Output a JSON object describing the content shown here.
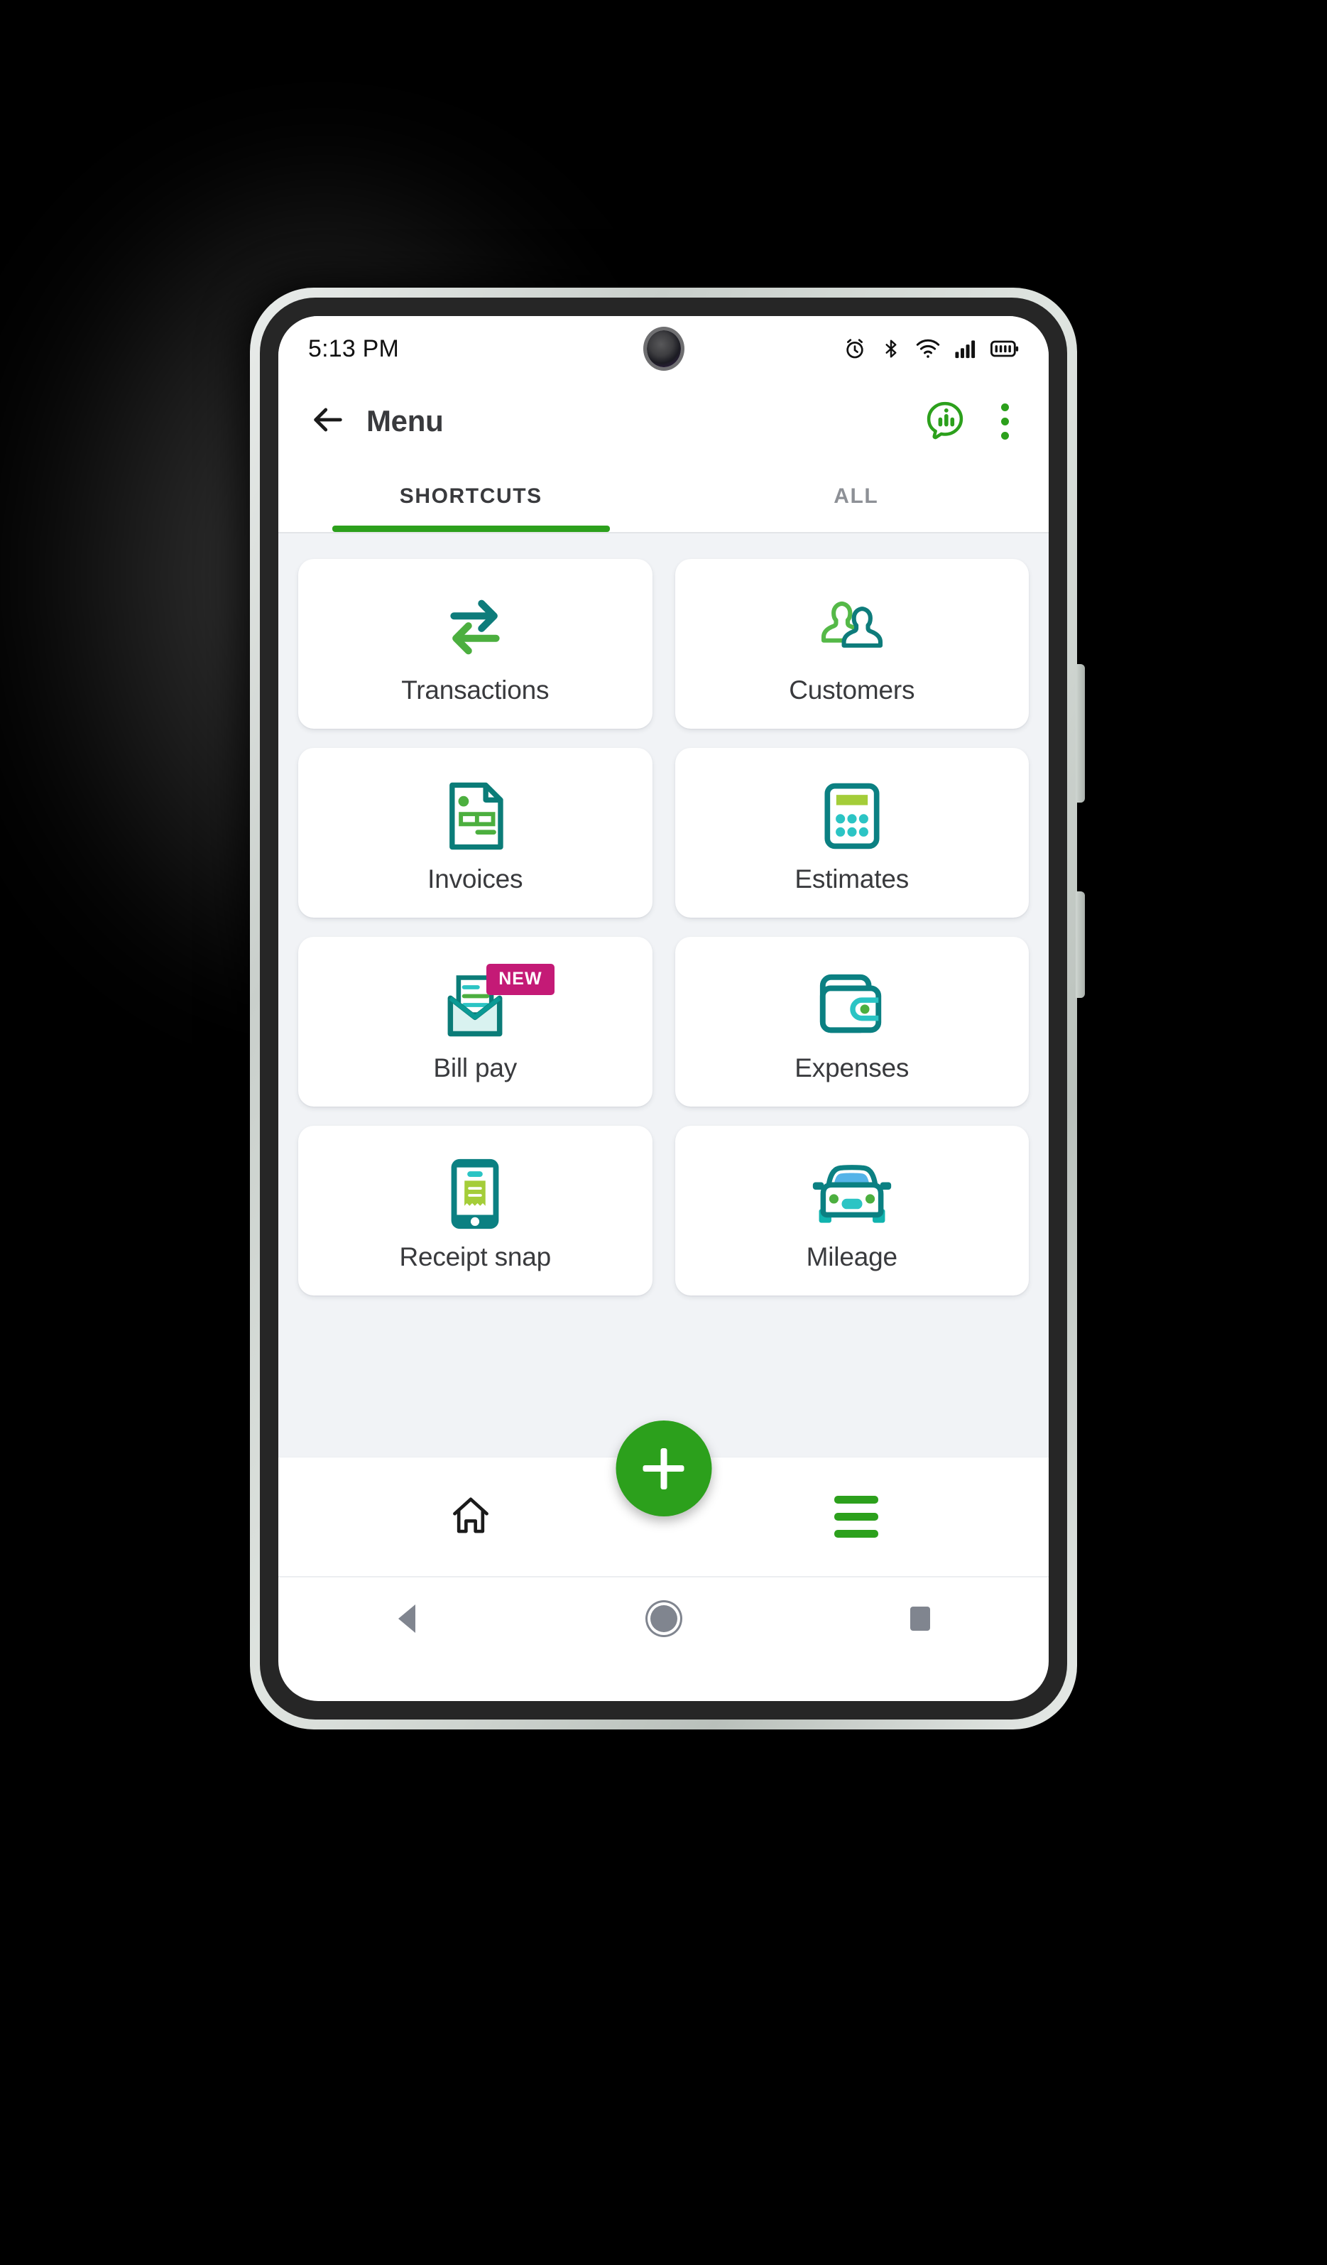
{
  "status_bar": {
    "time": "5:13 PM",
    "icons": [
      "alarm-icon",
      "bluetooth-icon",
      "wifi-icon",
      "cellular-signal-icon",
      "battery-icon"
    ]
  },
  "app_bar": {
    "back_icon": "arrow-left-icon",
    "title": "Menu",
    "assistant_icon": "assistant-chat-bars-icon",
    "overflow_icon": "overflow-menu-icon"
  },
  "tabs": {
    "items": [
      {
        "label": "SHORTCUTS",
        "active": true
      },
      {
        "label": "ALL",
        "active": false
      }
    ],
    "indicator_color": "#2ca01c"
  },
  "shortcuts": [
    {
      "label": "Transactions",
      "icon": "transfer-arrows-icon",
      "badge": null
    },
    {
      "label": "Customers",
      "icon": "people-icon",
      "badge": null
    },
    {
      "label": "Invoices",
      "icon": "invoice-document-icon",
      "badge": null
    },
    {
      "label": "Estimates",
      "icon": "calculator-icon",
      "badge": null
    },
    {
      "label": "Bill pay",
      "icon": "open-envelope-icon",
      "badge": "NEW"
    },
    {
      "label": "Expenses",
      "icon": "wallet-icon",
      "badge": null
    },
    {
      "label": "Receipt snap",
      "icon": "phone-receipt-icon",
      "badge": null
    },
    {
      "label": "Mileage",
      "icon": "car-front-icon",
      "badge": null
    }
  ],
  "bottom_nav": {
    "home_icon": "home-icon",
    "fab_icon": "plus-icon",
    "menu_icon": "hamburger-menu-icon"
  },
  "android_nav": {
    "back": "android-back-icon",
    "home": "android-home-icon",
    "recents": "android-recents-icon"
  },
  "colors": {
    "brand_green": "#2ca01c",
    "icon_teal": "#0e7c7b",
    "icon_green": "#4caf3f",
    "icon_cyan": "#2bc4c4",
    "icon_lime": "#a4cd39",
    "badge_magenta": "#c41a76",
    "text_dark": "#393a3d",
    "text_muted": "#8d9096",
    "content_bg": "#f1f3f6"
  }
}
